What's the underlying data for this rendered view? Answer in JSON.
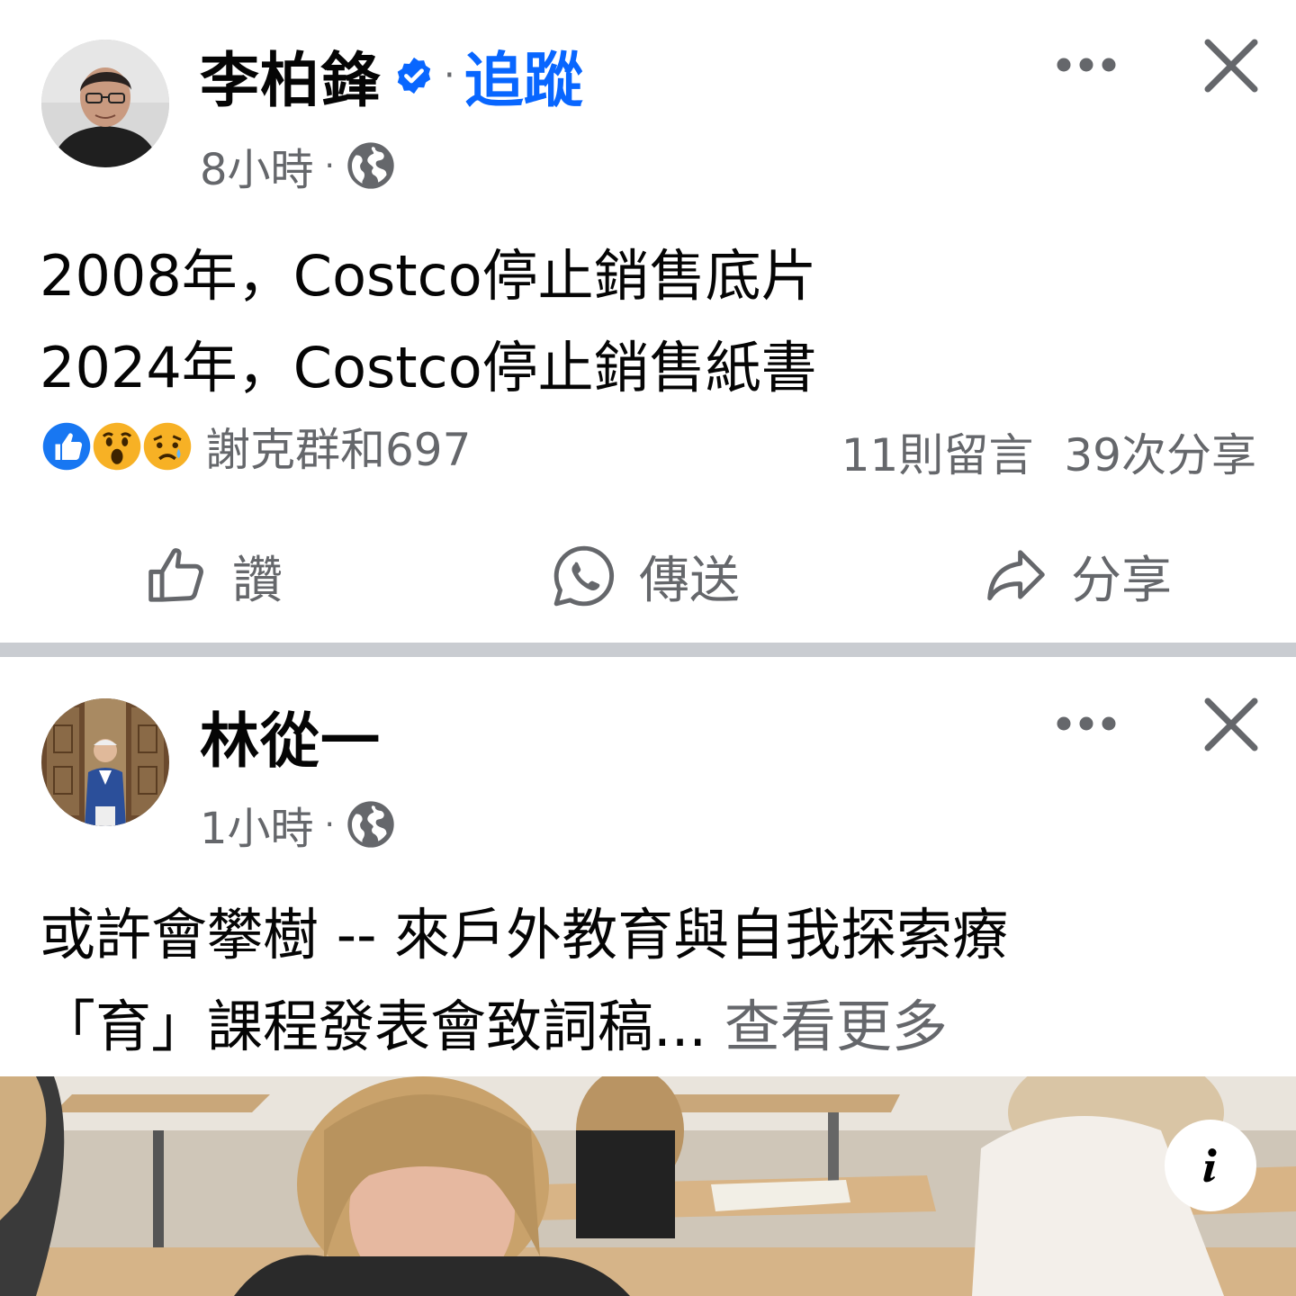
{
  "posts": [
    {
      "author": "李柏鋒",
      "verified": true,
      "separator": "·",
      "follow_label": "追蹤",
      "time": "8小時",
      "meta_separator": "·",
      "audience_icon": "globe-icon",
      "text_lines": [
        "2008年，Costco停止銷售底片",
        "2024年，Costco停止銷售紙書"
      ],
      "reaction_icons": [
        "like-reaction-icon",
        "wow-reaction-icon",
        "sad-reaction-icon"
      ],
      "reactions_text": "謝克群和697",
      "comments": "11則留言",
      "shares": "39次分享",
      "actions": {
        "like": "讚",
        "send": "傳送",
        "share": "分享"
      }
    },
    {
      "author": "林從一",
      "time": "1小時",
      "meta_separator": "·",
      "audience_icon": "globe-icon",
      "text_line1": "或許會攀樹 -- 來戶外教育與自我探索療",
      "text_line2": "「育」課程發表會致詞稿...",
      "see_more": "查看更多",
      "info_icon": "info-icon"
    }
  ],
  "colors": {
    "accent": "#0866ff",
    "secondary_text": "#65676b",
    "divider": "#c9ccd1"
  }
}
